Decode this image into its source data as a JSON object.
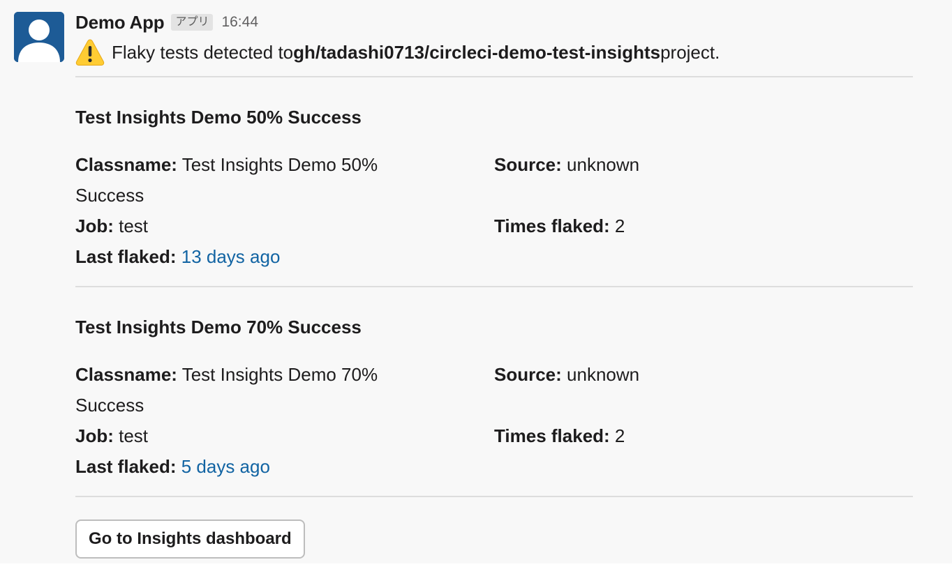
{
  "message": {
    "app_name": "Demo App",
    "app_badge": "アプリ",
    "timestamp": "16:44",
    "intro_prefix": "Flaky tests detected to ",
    "intro_project": "gh/tadashi0713/circleci-demo-test-insights",
    "intro_suffix": " project.",
    "warning_icon": "warning-icon"
  },
  "tests": [
    {
      "title": "Test Insights Demo 50% Success",
      "classname_label": "Classname:",
      "classname_value": " Test Insights Demo 50%",
      "classname_value_cont": "Success",
      "source_label": "Source:",
      "source_value": " unknown",
      "job_label": "Job:",
      "job_value": " test",
      "times_flaked_label": "Times flaked:",
      "times_flaked_value": " 2",
      "last_flaked_label": "Last flaked:",
      "last_flaked_value": "13 days ago"
    },
    {
      "title": "Test Insights Demo 70% Success",
      "classname_label": "Classname:",
      "classname_value": " Test Insights Demo 70%",
      "classname_value_cont": "Success",
      "source_label": "Source:",
      "source_value": " unknown",
      "job_label": "Job:",
      "job_value": " test",
      "times_flaked_label": "Times flaked:",
      "times_flaked_value": " 2",
      "last_flaked_label": "Last flaked:",
      "last_flaked_value": "5 days ago"
    }
  ],
  "actions": {
    "dashboard_button": "Go to Insights dashboard"
  },
  "colors": {
    "link": "#1264a3",
    "avatar_bg": "#1d5b96",
    "background": "#f8f8f8"
  }
}
